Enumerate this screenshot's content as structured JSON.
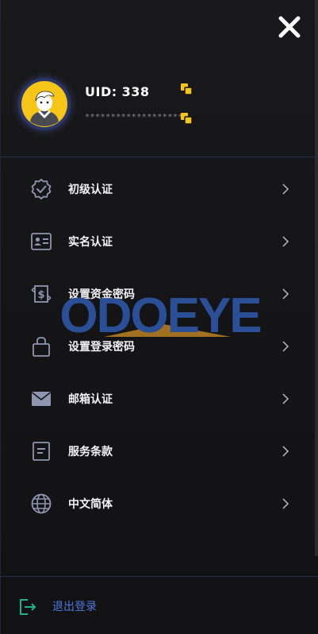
{
  "header": {
    "uid_label": "UID:",
    "uid_value": "338",
    "masked_text": "********************"
  },
  "menu": {
    "items": [
      {
        "label": "初级认证",
        "icon": "badge-check-icon"
      },
      {
        "label": "实名认证",
        "icon": "id-card-icon"
      },
      {
        "label": "设置资金密码",
        "icon": "dollar-exchange-icon"
      },
      {
        "label": "设置登录密码",
        "icon": "lock-icon"
      },
      {
        "label": "邮箱认证",
        "icon": "mail-icon"
      },
      {
        "label": "服务条款",
        "icon": "document-icon"
      },
      {
        "label": "中文简体",
        "icon": "globe-icon"
      }
    ]
  },
  "logout": {
    "label": "退出登录",
    "icon": "logout-icon"
  },
  "watermark": {
    "text": "ODOEYE"
  },
  "colors": {
    "accent_yellow": "#f5c518",
    "accent_blue": "#4e78e0",
    "logout_green": "#1fb08e",
    "icon_gray": "#8e95b0"
  }
}
